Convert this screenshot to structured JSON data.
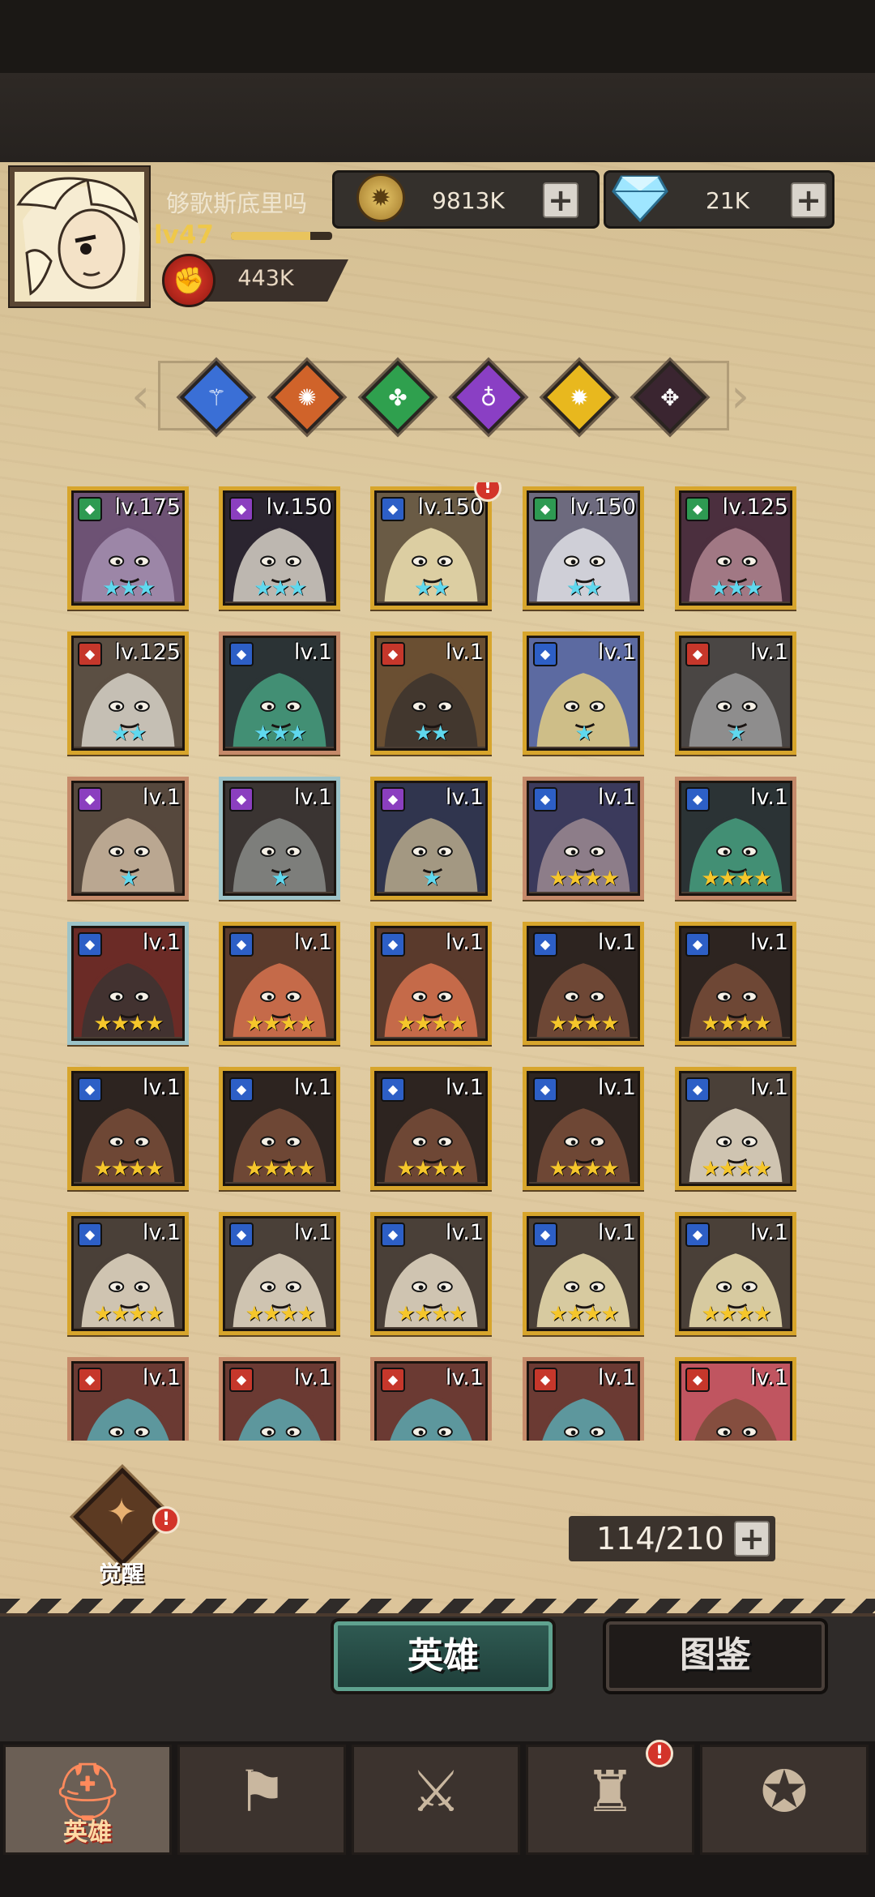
{
  "player": {
    "name": "够歌斯底里吗",
    "level": "lv47",
    "xp_fraction": 0.78,
    "power": "443K"
  },
  "resources": {
    "gold": "9813K",
    "gems": "21K",
    "plus_glyph": "+"
  },
  "factions": [
    {
      "name": "faction-blue",
      "color": "#3a6fd6",
      "glyph": "⚚"
    },
    {
      "name": "faction-orange",
      "color": "#d0632a",
      "glyph": "✺"
    },
    {
      "name": "faction-green",
      "color": "#2fa04e",
      "glyph": "✤"
    },
    {
      "name": "faction-purple",
      "color": "#8a3fc4",
      "glyph": "♁"
    },
    {
      "name": "faction-yellow",
      "color": "#e8b81e",
      "glyph": "✹"
    },
    {
      "name": "faction-dark",
      "color": "#3a2530",
      "glyph": "✥"
    }
  ],
  "heroes": [
    {
      "level": "lv.175",
      "stars": "★★★",
      "star_color": "#5fd8ee",
      "cls_color": "#2e9a52",
      "art": [
        "#a58fb0",
        "#6d5274"
      ],
      "frame": "gold",
      "alert": false
    },
    {
      "level": "lv.150",
      "stars": "★★★",
      "star_color": "#5fd8ee",
      "cls_color": "#8b3fbf",
      "art": [
        "#d7d1c7",
        "#2b2530"
      ],
      "frame": "gold",
      "alert": false
    },
    {
      "level": "lv.150",
      "stars": "★★",
      "star_color": "#5fd8ee",
      "cls_color": "#2d5fc6",
      "art": [
        "#f0e3b3",
        "#6a5b45"
      ],
      "frame": "gold",
      "alert": true
    },
    {
      "level": "lv.150",
      "stars": "★★",
      "star_color": "#5fd8ee",
      "cls_color": "#2e9a52",
      "art": [
        "#e1e0e6",
        "#6d6a7e"
      ],
      "frame": "gold",
      "alert": false
    },
    {
      "level": "lv.125",
      "stars": "★★★",
      "star_color": "#5fd8ee",
      "cls_color": "#2e9a52",
      "art": [
        "#b08590",
        "#4b2f3e"
      ],
      "frame": "gold",
      "alert": false
    },
    {
      "level": "lv.125",
      "stars": "★★",
      "star_color": "#5fd8ee",
      "cls_color": "#c6372b",
      "art": [
        "#d8d2c8",
        "#5b4f43"
      ],
      "frame": "gold",
      "alert": false
    },
    {
      "level": "lv.1",
      "stars": "★★★",
      "star_color": "#5fd8ee",
      "cls_color": "#2d5fc6",
      "art": [
        "#47a07f",
        "#2b3335"
      ],
      "frame": "bronze",
      "alert": false
    },
    {
      "level": "lv.1",
      "stars": "★★",
      "star_color": "#5fd8ee",
      "cls_color": "#c6372b",
      "art": [
        "#3b332e",
        "#6a4f32"
      ],
      "frame": "gold",
      "alert": false
    },
    {
      "level": "lv.1",
      "stars": "★",
      "star_color": "#5fd8ee",
      "cls_color": "#2d5fc6",
      "art": [
        "#e2cd84",
        "#5c6aa1"
      ],
      "frame": "gold",
      "alert": false
    },
    {
      "level": "lv.1",
      "stars": "★",
      "star_color": "#5fd8ee",
      "cls_color": "#c6372b",
      "art": [
        "#9a9a9a",
        "#4a4644"
      ],
      "frame": "gold",
      "alert": false
    },
    {
      "level": "lv.1",
      "stars": "★",
      "star_color": "#5fd8ee",
      "cls_color": "#8b3fbf",
      "art": [
        "#cbb9a0",
        "#56483d"
      ],
      "frame": "bronze",
      "alert": false
    },
    {
      "level": "lv.1",
      "stars": "★",
      "star_color": "#5fd8ee",
      "cls_color": "#8b3fbf",
      "art": [
        "#8a8c88",
        "#3a3432"
      ],
      "frame": "silver",
      "alert": false
    },
    {
      "level": "lv.1",
      "stars": "★",
      "star_color": "#5fd8ee",
      "cls_color": "#8b3fbf",
      "art": [
        "#b7a98c",
        "#30354e"
      ],
      "frame": "gold",
      "alert": false
    },
    {
      "level": "lv.1",
      "stars": "★★★★",
      "star_color": "#f5c62b",
      "cls_color": "#2d5fc6",
      "art": [
        "#9c8a90",
        "#3b3a5c"
      ],
      "frame": "bronze",
      "alert": false
    },
    {
      "level": "lv.1",
      "stars": "★★★★",
      "star_color": "#f5c62b",
      "cls_color": "#2d5fc6",
      "art": [
        "#47a07f",
        "#2b3335"
      ],
      "frame": "bronze",
      "alert": false
    },
    {
      "level": "lv.1",
      "stars": "★★★★",
      "star_color": "#f5c62b",
      "cls_color": "#2d5fc6",
      "art": [
        "#3b3433",
        "#6b2b26"
      ],
      "frame": "silver",
      "alert": false
    },
    {
      "level": "lv.1",
      "stars": "★★★★",
      "star_color": "#f5c62b",
      "cls_color": "#2d5fc6",
      "art": [
        "#d8734f",
        "#5a3a2c"
      ],
      "frame": "gold",
      "alert": false
    },
    {
      "level": "lv.1",
      "stars": "★★★★",
      "star_color": "#f5c62b",
      "cls_color": "#2d5fc6",
      "art": [
        "#d8734f",
        "#5a3a2c"
      ],
      "frame": "gold",
      "alert": false
    },
    {
      "level": "lv.1",
      "stars": "★★★★",
      "star_color": "#f5c62b",
      "cls_color": "#2d5fc6",
      "art": [
        "#7a4d3a",
        "#2d2420"
      ],
      "frame": "gold",
      "alert": false
    },
    {
      "level": "lv.1",
      "stars": "★★★★",
      "star_color": "#f5c62b",
      "cls_color": "#2d5fc6",
      "art": [
        "#7a4d3a",
        "#2d2420"
      ],
      "frame": "gold",
      "alert": false
    },
    {
      "level": "lv.1",
      "stars": "★★★★",
      "star_color": "#f5c62b",
      "cls_color": "#2d5fc6",
      "art": [
        "#7a4d3a",
        "#2d2420"
      ],
      "frame": "gold",
      "alert": false
    },
    {
      "level": "lv.1",
      "stars": "★★★★",
      "star_color": "#f5c62b",
      "cls_color": "#2d5fc6",
      "art": [
        "#7a4d3a",
        "#2d2420"
      ],
      "frame": "gold",
      "alert": false
    },
    {
      "level": "lv.1",
      "stars": "★★★★",
      "star_color": "#f5c62b",
      "cls_color": "#2d5fc6",
      "art": [
        "#7a4d3a",
        "#2d2420"
      ],
      "frame": "gold",
      "alert": false
    },
    {
      "level": "lv.1",
      "stars": "★★★★",
      "star_color": "#f5c62b",
      "cls_color": "#2d5fc6",
      "art": [
        "#7a4d3a",
        "#2d2420"
      ],
      "frame": "gold",
      "alert": false
    },
    {
      "level": "lv.1",
      "stars": "★★★★",
      "star_color": "#f5c62b",
      "cls_color": "#2d5fc6",
      "art": [
        "#e6dcc7",
        "#4a4038"
      ],
      "frame": "gold",
      "alert": false
    },
    {
      "level": "lv.1",
      "stars": "★★★★",
      "star_color": "#f5c62b",
      "cls_color": "#2d5fc6",
      "art": [
        "#e6dcc7",
        "#4a4038"
      ],
      "frame": "gold",
      "alert": false
    },
    {
      "level": "lv.1",
      "stars": "★★★★",
      "star_color": "#f5c62b",
      "cls_color": "#2d5fc6",
      "art": [
        "#e6dcc7",
        "#4a4038"
      ],
      "frame": "gold",
      "alert": false
    },
    {
      "level": "lv.1",
      "stars": "★★★★",
      "star_color": "#f5c62b",
      "cls_color": "#2d5fc6",
      "art": [
        "#e6dcc7",
        "#4a4038"
      ],
      "frame": "gold",
      "alert": false
    },
    {
      "level": "lv.1",
      "stars": "★★★★",
      "star_color": "#f5c62b",
      "cls_color": "#2d5fc6",
      "art": [
        "#f0e3b3",
        "#4a4038"
      ],
      "frame": "gold",
      "alert": false
    },
    {
      "level": "lv.1",
      "stars": "★★★★",
      "star_color": "#f5c62b",
      "cls_color": "#2d5fc6",
      "art": [
        "#f0e3b3",
        "#4a4038"
      ],
      "frame": "gold",
      "alert": false
    },
    {
      "level": "lv.1",
      "stars": "",
      "star_color": "#f5c62b",
      "cls_color": "#c6372b",
      "art": [
        "#5aa8b0",
        "#6b3a33"
      ],
      "frame": "bronze",
      "alert": false
    },
    {
      "level": "lv.1",
      "stars": "",
      "star_color": "#f5c62b",
      "cls_color": "#c6372b",
      "art": [
        "#5aa8b0",
        "#6b3a33"
      ],
      "frame": "bronze",
      "alert": false
    },
    {
      "level": "lv.1",
      "stars": "",
      "star_color": "#f5c62b",
      "cls_color": "#c6372b",
      "art": [
        "#5aa8b0",
        "#6b3a33"
      ],
      "frame": "bronze",
      "alert": false
    },
    {
      "level": "lv.1",
      "stars": "",
      "star_color": "#f5c62b",
      "cls_color": "#c6372b",
      "art": [
        "#5aa8b0",
        "#6b3a33"
      ],
      "frame": "bronze",
      "alert": false
    },
    {
      "level": "lv.1",
      "stars": "",
      "star_color": "#f5c62b",
      "cls_color": "#c6372b",
      "art": [
        "#7a4d3a",
        "#c05560"
      ],
      "frame": "gold",
      "alert": false
    }
  ],
  "awaken": {
    "label": "觉醒",
    "icon": "awaken-swirl-icon",
    "alert": "!"
  },
  "roster": {
    "capacity": "114/210"
  },
  "tabs": {
    "hero": "英雄",
    "codex": "图鉴"
  },
  "nav": [
    {
      "name": "heroes",
      "label": "英雄",
      "icon": "helmet-icon",
      "glyph": "⛑",
      "active": true,
      "alert": false
    },
    {
      "name": "expedition",
      "label": "",
      "icon": "flag-icon",
      "glyph": "⚑",
      "active": false,
      "alert": false
    },
    {
      "name": "battle",
      "label": "",
      "icon": "crossed-swords-icon",
      "glyph": "⚔",
      "active": false,
      "alert": false
    },
    {
      "name": "castle",
      "label": "",
      "icon": "castle-icon",
      "glyph": "♜",
      "active": false,
      "alert": true
    },
    {
      "name": "guild",
      "label": "",
      "icon": "handshake-emblem-icon",
      "glyph": "✪",
      "active": false,
      "alert": false
    }
  ],
  "alert_glyph": "!"
}
